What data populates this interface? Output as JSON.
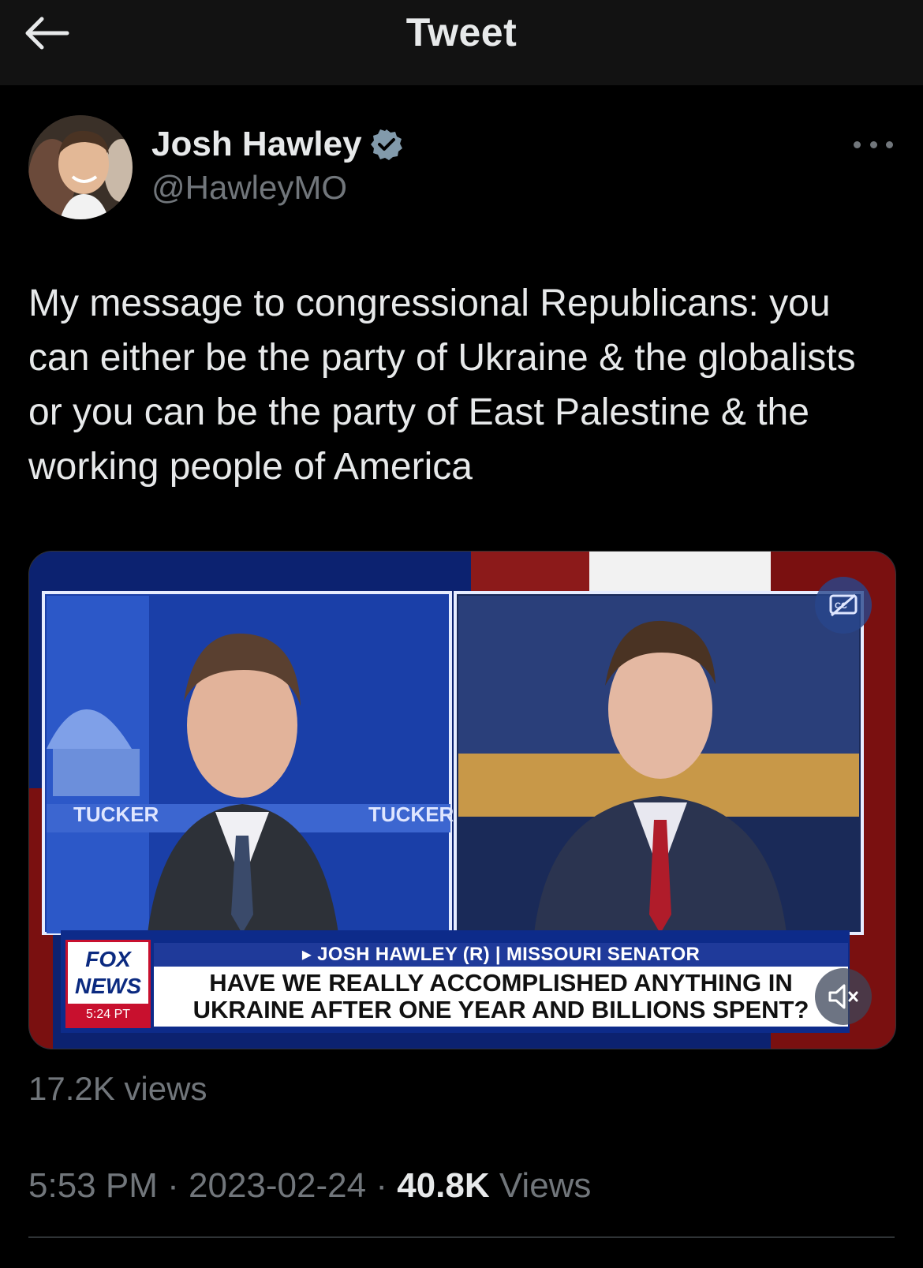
{
  "header": {
    "title": "Tweet"
  },
  "author": {
    "name": "Josh Hawley",
    "handle": "@HawleyMO",
    "verified": true
  },
  "tweet": {
    "text": "My message to congressional Republicans: you can either be the party of Ukraine & the globalists or you can be the party of East Palestine & the working people of America"
  },
  "media": {
    "type": "video",
    "show_label_left": "TUCKER",
    "show_label_right": "TUCKER",
    "chyron_name": "▸ JOSH HAWLEY (R) | MISSOURI SENATOR",
    "chyron_line1": "HAVE WE REALLY ACCOMPLISHED ANYTHING IN",
    "chyron_line2": "UKRAINE AFTER ONE YEAR AND BILLIONS SPENT?",
    "logo_line1": "FOX",
    "logo_line2": "NEWS",
    "logo_time": "5:24 PT",
    "captions_icon": "closed-captions-icon",
    "mute_icon": "muted-speaker-icon",
    "view_count": "17.2K views"
  },
  "meta": {
    "time": "5:53 PM",
    "date": "2023-02-24",
    "views_count": "40.8K",
    "views_label": "Views",
    "separator": "·"
  },
  "colors": {
    "background": "#000000",
    "header_bg": "#121212",
    "primary_text": "#e7e9ea",
    "secondary_text": "#71767b",
    "verified_badge": "#829aab",
    "divider": "#2f3336"
  }
}
